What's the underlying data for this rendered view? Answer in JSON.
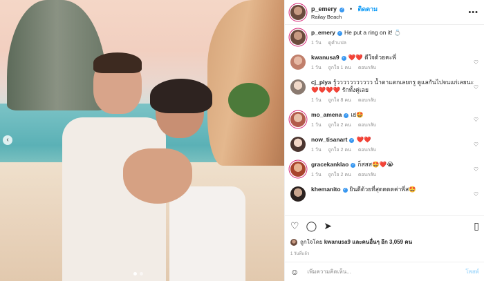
{
  "post": {
    "username": "p_emery",
    "follow_label": "ติดตาม",
    "location": "Railay Beach",
    "more_label": "•••"
  },
  "caption": {
    "username": "p_emery",
    "text": "He put a ring on it! 💍",
    "time": "1 วัน",
    "translate": "ดูคำแปล"
  },
  "comments": [
    {
      "username": "kwanusa9",
      "text": "❤️❤️ ดีใจด้วยคะพี่",
      "time": "1 วัน",
      "likes": "ถูกใจ 1 คน",
      "reply": "ตอบกลับ"
    },
    {
      "username": "cj_piya",
      "text": "รู้ววววววววววว น้ำตาแตกเลยกรู ดูแลกันไปจนแก่เลยนะ ❤️❤️❤️❤️ รักทั้งคู่เลย",
      "time": "1 วัน",
      "likes": "ถูกใจ 8 คน",
      "reply": "ตอบกลับ"
    },
    {
      "username": "mo_amena",
      "text": "เย่🤩",
      "time": "1 วัน",
      "likes": "ถูกใจ 2 คน",
      "reply": "ตอบกลับ"
    },
    {
      "username": "now_tisanart",
      "text": "❤️❤️",
      "time": "1 วัน",
      "likes": "ถูกใจ 2 คน",
      "reply": "ตอบกลับ"
    },
    {
      "username": "gracekanklao",
      "text": "ก็สสส🤩❤️😭",
      "time": "1 วัน",
      "likes": "ถูกใจ 2 คน",
      "reply": "ตอบกลับ"
    },
    {
      "username": "khemanito",
      "text": "ยินดีด้วยที่สุดดดดค่าพี่ส🤩",
      "time": "",
      "likes": "",
      "reply": ""
    }
  ],
  "likes_line": {
    "prefix": "ถูกใจโดย",
    "user": "kwanusa9",
    "suffix": "และคนอื่นๆ อีก 3,059 คน"
  },
  "date": "1 วันที่แล้ว",
  "add_comment": {
    "placeholder": "เพิ่มความคิดเห็น...",
    "post_label": "โพสต์"
  },
  "colors": {
    "link": "#0095f6",
    "muted": "#8e8e8e",
    "verified": "#3897f0"
  },
  "icons": [
    "heart-icon",
    "comment-icon",
    "share-icon",
    "bookmark-icon",
    "smile-icon",
    "more-icon",
    "verified-icon"
  ]
}
